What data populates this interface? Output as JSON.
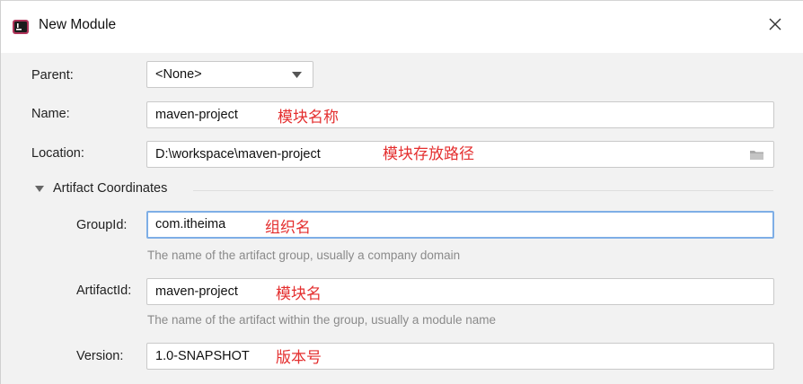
{
  "window": {
    "title": "New Module",
    "close_icon": "close-icon",
    "app_icon": "intellij-app-icon"
  },
  "form": {
    "parent": {
      "label": "Parent:",
      "value": "<None>"
    },
    "name": {
      "label": "Name:",
      "value": "maven-project",
      "annotation": "模块名称"
    },
    "location": {
      "label": "Location:",
      "value": "D:\\workspace\\maven-project",
      "annotation": "模块存放路径"
    }
  },
  "artifact": {
    "section_title": "Artifact Coordinates",
    "group_id": {
      "label": "GroupId:",
      "value": "com.itheima",
      "annotation": "组织名",
      "hint": "The name of the artifact group, usually a company domain"
    },
    "artifact_id": {
      "label": "ArtifactId:",
      "value": "maven-project",
      "annotation": "模块名",
      "hint": "The name of the artifact within the group, usually a module name"
    },
    "version": {
      "label": "Version:",
      "value": "1.0-SNAPSHOT",
      "annotation": "版本号"
    }
  },
  "colors": {
    "annotation": "#e42f2f",
    "focus_border": "#7eaee6",
    "background": "#f2f2f2"
  }
}
